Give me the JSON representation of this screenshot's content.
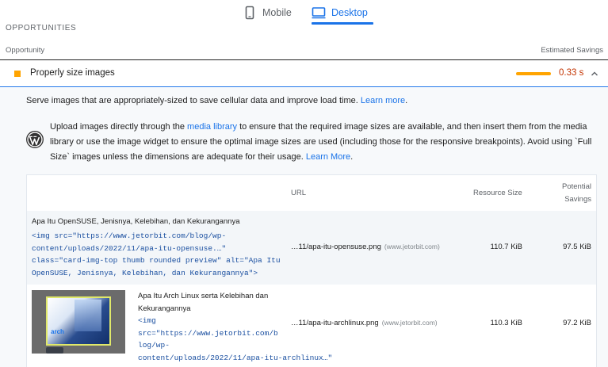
{
  "tabs": {
    "mobile": {
      "label": "Mobile",
      "icon": "mobile-icon"
    },
    "desktop": {
      "label": "Desktop",
      "icon": "desktop-icon",
      "active": true
    }
  },
  "section_title": "OPPORTUNITIES",
  "columns": {
    "left": "Opportunity",
    "right": "Estimated Savings"
  },
  "audit": {
    "title": "Properly size images",
    "savings": "0.33 s",
    "status_color": "#ffa400",
    "savings_color": "#c33300",
    "savings_bar_fraction": 0.5
  },
  "description": {
    "text": "Serve images that are appropriately-sized to save cellular data and improve load time.",
    "link": "Learn more"
  },
  "stack_pack": {
    "icon": "wordpress-icon",
    "text_1": "Upload images directly through the ",
    "link_1": "media library",
    "text_2": " to ensure that the required image sizes are available, and then insert them from the media library or use the image widget to ensure the optimal image sizes are used (including those for the responsive breakpoints). Avoid using `Full Size` images unless the dimensions are adequate for their usage. ",
    "link_2": "Learn More"
  },
  "table": {
    "headers": {
      "url": "URL",
      "resource_size": "Resource Size",
      "potential_savings_1": "Potential",
      "potential_savings_2": "Savings"
    },
    "rows": [
      {
        "node_label": "Apa Itu OpenSUSE, Jenisnya, Kelebihan, dan Kekurangannya",
        "snippet": "<img src=\"https://www.jetorbit.com/blog/wp-\ncontent/uploads/2022/11/apa-itu-opensuse.…\"\nclass=\"card-img-top thumb rounded preview\" alt=\"Apa Itu\nOpenSUSE, Jenisnya, Kelebihan, dan Kekurangannya\">",
        "url": "…11/apa-itu-opensuse.png",
        "host": "(www.jetorbit.com)",
        "resource_size": "110.7 KiB",
        "savings": "97.5 KiB"
      },
      {
        "node_label": "Apa Itu Arch Linux serta Kelebihan dan\nKekurangannya",
        "snippet": "<img\nsrc=\"https://www.jetorbit.com/b\nlog/wp-\ncontent/uploads/2022/11/apa-itu-archlinux…\"",
        "thumbnail_text": "arch",
        "url": "…11/apa-itu-archlinux.png",
        "host": "(www.jetorbit.com)",
        "resource_size": "110.3 KiB",
        "savings": "97.2 KiB"
      }
    ]
  }
}
